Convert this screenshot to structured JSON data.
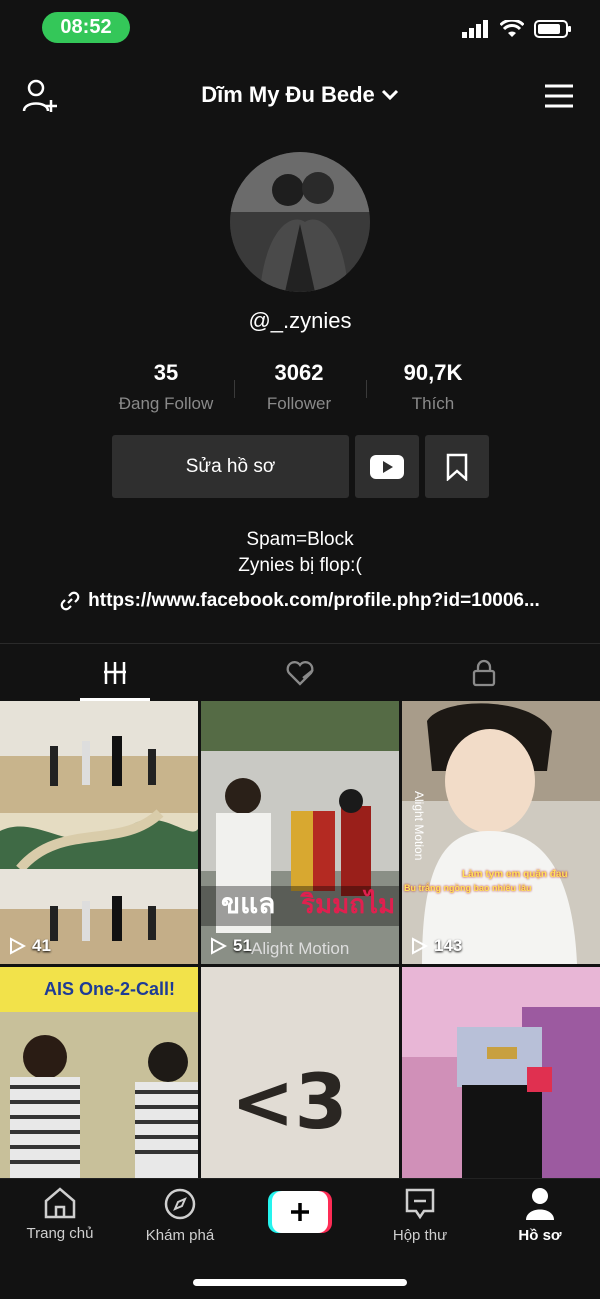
{
  "status_bar": {
    "time": "08:52"
  },
  "header": {
    "title": "Dĩm My Đu Bede"
  },
  "profile": {
    "username": "@_.zynies",
    "stats": [
      {
        "value": "35",
        "label": "Đang Follow"
      },
      {
        "value": "3062",
        "label": "Follower"
      },
      {
        "value": "90,7K",
        "label": "Thích"
      }
    ],
    "edit_label": "Sửa hồ sơ",
    "bio_lines": [
      "Spam=Block",
      "Zynies bị flop:("
    ],
    "link": "https://www.facebook.com/profile.php?id=10006..."
  },
  "videos": [
    {
      "views": "41",
      "overlay": ""
    },
    {
      "views": "51",
      "overlay": "Alight Motion"
    },
    {
      "views": "143",
      "overlay": "Alight Motion",
      "caption": "Làm tym em quặn đau",
      "caption2": "Bu trắng ngồng bao nhiêu lâu"
    },
    {
      "views": "",
      "overlay": "AIS One-2-Call!"
    },
    {
      "views": "",
      "overlay": "<3"
    },
    {
      "views": "",
      "overlay": ""
    }
  ],
  "nav": [
    {
      "label": "Trang chủ",
      "icon": "home-icon"
    },
    {
      "label": "Khám phá",
      "icon": "compass-icon"
    },
    {
      "label": "",
      "icon": "plus-icon"
    },
    {
      "label": "Hộp thư",
      "icon": "inbox-icon"
    },
    {
      "label": "Hồ sơ",
      "icon": "profile-icon"
    }
  ],
  "colors": {
    "status_pill": "#34c759",
    "background": "#121212",
    "plus_cyan": "#25f4ee",
    "plus_pink": "#fe2c55"
  }
}
